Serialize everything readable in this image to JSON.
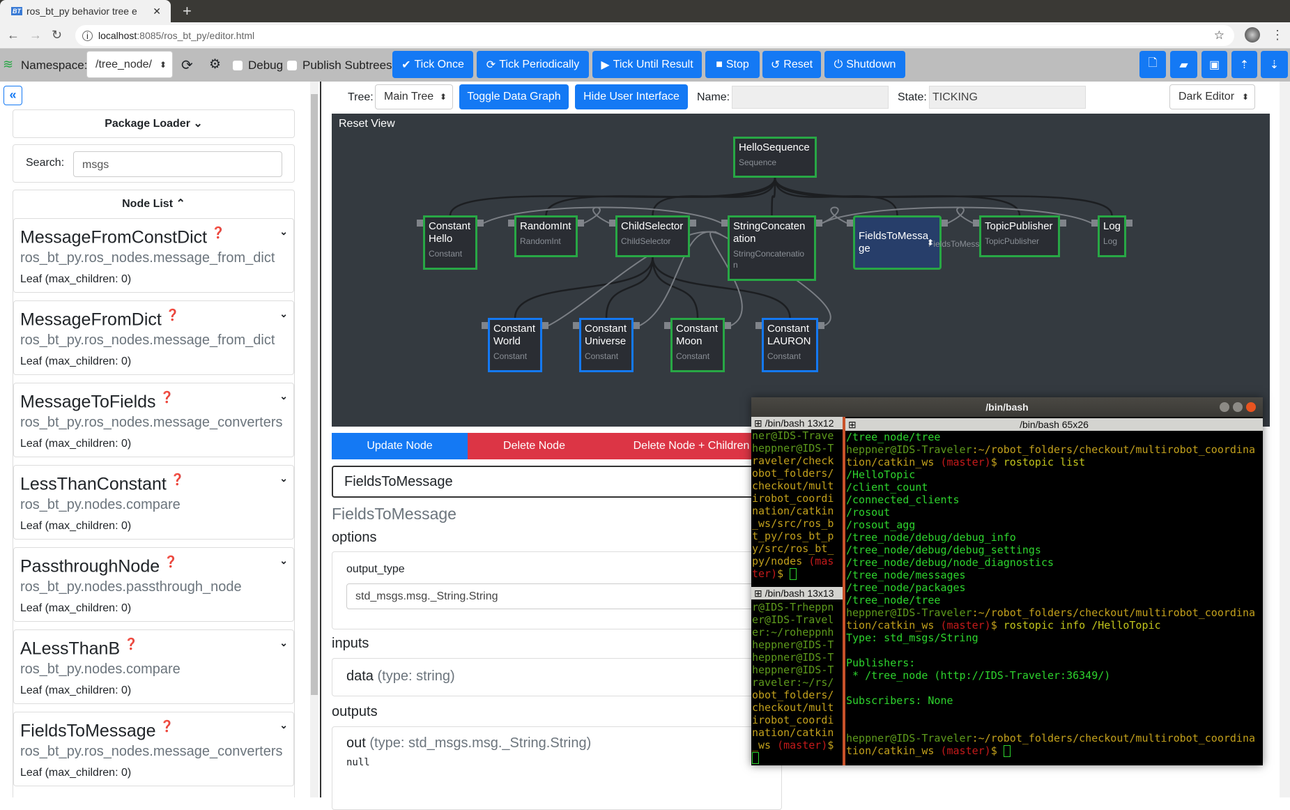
{
  "browser": {
    "tab_title": "ros_bt_py behavior tree e",
    "favicon": "BT",
    "url_host": "localhost",
    "url_rest": ":8085/ros_bt_py/editor.html"
  },
  "toolbar": {
    "namespace_label": "Namespace:",
    "namespace_value": "/tree_node/",
    "debug_label": "Debug",
    "publish_label": "Publish Subtrees",
    "tick_once": "Tick Once",
    "tick_periodically": "Tick Periodically",
    "tick_until_result": "Tick Until Result",
    "stop": "Stop",
    "reset": "Reset",
    "shutdown": "Shutdown",
    "right_icons": [
      "new-file-icon",
      "open-folder-icon",
      "save-icon",
      "upload-file-icon",
      "download-file-icon"
    ]
  },
  "sidebar": {
    "collapse": "«",
    "package_loader": "Package Loader ⌄",
    "search_label": "Search:",
    "search_value": "msgs",
    "node_list": "Node List ⌃",
    "items": [
      {
        "title": "MessageFromConstDict",
        "module": "ros_bt_py.ros_nodes.message_from_dict",
        "leaf": "Leaf (max_children: 0)"
      },
      {
        "title": "MessageFromDict",
        "module": "ros_bt_py.ros_nodes.message_from_dict",
        "leaf": "Leaf (max_children: 0)"
      },
      {
        "title": "MessageToFields",
        "module": "ros_bt_py.ros_nodes.message_converters",
        "leaf": "Leaf (max_children: 0)"
      },
      {
        "title": "LessThanConstant",
        "module": "ros_bt_py.nodes.compare",
        "leaf": "Leaf (max_children: 0)"
      },
      {
        "title": "PassthroughNode",
        "module": "ros_bt_py.nodes.passthrough_node",
        "leaf": "Leaf (max_children: 0)"
      },
      {
        "title": "ALessThanB",
        "module": "ros_bt_py.nodes.compare",
        "leaf": "Leaf (max_children: 0)"
      },
      {
        "title": "FieldsToMessage",
        "module": "ros_bt_py.ros_nodes.message_converters",
        "leaf": "Leaf (max_children: 0)"
      }
    ]
  },
  "treebar": {
    "tree_label": "Tree:",
    "tree_value": "Main Tree",
    "toggle_data_graph": "Toggle Data Graph",
    "hide_ui": "Hide User Interface",
    "name_label": "Name:",
    "name_value": "",
    "state_label": "State:",
    "state_value": "TICKING",
    "theme": "Dark Editor"
  },
  "graph": {
    "reset_view": "Reset View",
    "nodes": [
      {
        "id": "seq",
        "title": "HelloSequence",
        "type": "Sequence",
        "state": "green"
      },
      {
        "id": "hello",
        "title": "Constant Hello",
        "type": "Constant",
        "state": "green",
        "parent": "seq"
      },
      {
        "id": "rand",
        "title": "RandomInt",
        "type": "RandomInt",
        "state": "green",
        "parent": "seq"
      },
      {
        "id": "cs",
        "title": "ChildSelector",
        "type": "ChildSelector",
        "state": "green",
        "parent": "seq"
      },
      {
        "id": "sc",
        "title": "StringConcaten ation",
        "type": "StringConcatenatio n",
        "state": "green",
        "parent": "seq"
      },
      {
        "id": "ftm",
        "title": "FieldsToMessa ge",
        "type": "FieldsToMessage",
        "state": "green",
        "parent": "seq",
        "selected": true
      },
      {
        "id": "tp",
        "title": "TopicPublisher",
        "type": "TopicPublisher",
        "state": "green",
        "parent": "seq"
      },
      {
        "id": "log",
        "title": "Log",
        "type": "Log",
        "state": "green",
        "parent": "seq"
      },
      {
        "id": "world",
        "title": "Constant World",
        "type": "Constant",
        "state": "blue",
        "parent": "cs"
      },
      {
        "id": "univ",
        "title": "Constant Universe",
        "type": "Constant",
        "state": "blue",
        "parent": "cs"
      },
      {
        "id": "moon",
        "title": "Constant Moon",
        "type": "Constant",
        "state": "green",
        "parent": "cs"
      },
      {
        "id": "lauron",
        "title": "Constant LAURON",
        "type": "Constant",
        "state": "blue",
        "parent": "cs"
      }
    ],
    "data_edges": [
      [
        "hello",
        "sc"
      ],
      [
        "rand",
        "cs"
      ],
      [
        "world",
        "sc"
      ],
      [
        "univ",
        "sc"
      ],
      [
        "moon",
        "sc"
      ],
      [
        "lauron",
        "sc"
      ],
      [
        "sc",
        "ftm"
      ],
      [
        "ftm",
        "tp"
      ],
      [
        "sc",
        "log"
      ]
    ],
    "colors": {
      "green": "#28a745",
      "blue": "#1479f4",
      "selected_bg": "#273e6a"
    }
  },
  "editor": {
    "update": "Update Node",
    "delete": "Delete Node",
    "delete_children": "Delete Node + Children",
    "name_value": "FieldsToMessage",
    "node_class": "FieldsToMessage",
    "options_heading": "options",
    "option_key": "output_type",
    "option_value": "std_msgs.msg._String.String",
    "inputs_heading": "inputs",
    "input_name": "data",
    "input_type": "(type: string)",
    "outputs_heading": "outputs",
    "output_name": "out",
    "output_type": "(type: std_msgs.msg._String.String)",
    "output_value": "null"
  },
  "terminal": {
    "title": "/bin/bash",
    "pane1_title": "/bin/bash 13x12",
    "pane2_title": "/bin/bash 13x13",
    "pane3_title": "/bin/bash 65x26",
    "pane1": [
      [
        [
          "g",
          "ner@IDS-Trave"
        ]
      ],
      [
        [
          "g",
          "heppner@IDS-T"
        ]
      ],
      [
        [
          "y",
          "raveler/check"
        ]
      ],
      [
        [
          "y",
          "obot_folders/"
        ]
      ],
      [
        [
          "y",
          "checkout/mult"
        ]
      ],
      [
        [
          "y",
          "irobot_coordi"
        ]
      ],
      [
        [
          "y",
          "nation/catkin"
        ]
      ],
      [
        [
          "y",
          "_ws/src/ros_b"
        ]
      ],
      [
        [
          "y",
          "t_py/ros_bt_p"
        ]
      ],
      [
        [
          "y",
          "y/src/ros_bt_"
        ]
      ],
      [
        [
          "y",
          "py/nodes "
        ],
        [
          "r",
          "(mas"
        ]
      ],
      [
        [
          "r",
          "ter)"
        ],
        [
          "y",
          "$ "
        ],
        [
          "cur",
          ""
        ]
      ]
    ],
    "pane2": [
      [
        [
          "g",
          "r@IDS-Trheppn"
        ]
      ],
      [
        [
          "g",
          "er@IDS-Travel"
        ]
      ],
      [
        [
          "g",
          "er:~/roheppnh"
        ]
      ],
      [
        [
          "g",
          "heppner@IDS-T"
        ]
      ],
      [
        [
          "g",
          "heppner@IDS-T"
        ]
      ],
      [
        [
          "g",
          "heppner@IDS-T"
        ]
      ],
      [
        [
          "g",
          "raveler:~/rs/"
        ]
      ],
      [
        [
          "y",
          "obot_folders/"
        ]
      ],
      [
        [
          "y",
          "checkout/mult"
        ]
      ],
      [
        [
          "y",
          "irobot_coordi"
        ]
      ],
      [
        [
          "y",
          "nation/catkin"
        ]
      ],
      [
        [
          "y",
          "_ws "
        ],
        [
          "r",
          "(master)"
        ],
        [
          "y",
          "$"
        ]
      ],
      [
        [
          "cur",
          ""
        ]
      ]
    ],
    "pane3": [
      [
        [
          "o",
          "/tree_node/tree"
        ]
      ],
      [
        [
          "g",
          "heppner@IDS-Traveler"
        ],
        [
          "y",
          ":~/robot_folders/checkout/multirobot_coordina"
        ]
      ],
      [
        [
          "y",
          "tion/catkin_ws "
        ],
        [
          "r",
          "(master)"
        ],
        [
          "y",
          "$ "
        ],
        [
          "cmd",
          "rostopic list"
        ]
      ],
      [
        [
          "o",
          "/HelloTopic"
        ]
      ],
      [
        [
          "o",
          "/client_count"
        ]
      ],
      [
        [
          "o",
          "/connected_clients"
        ]
      ],
      [
        [
          "o",
          "/rosout"
        ]
      ],
      [
        [
          "o",
          "/rosout_agg"
        ]
      ],
      [
        [
          "o",
          "/tree_node/debug/debug_info"
        ]
      ],
      [
        [
          "o",
          "/tree_node/debug/debug_settings"
        ]
      ],
      [
        [
          "o",
          "/tree_node/debug/node_diagnostics"
        ]
      ],
      [
        [
          "o",
          "/tree_node/messages"
        ]
      ],
      [
        [
          "o",
          "/tree_node/packages"
        ]
      ],
      [
        [
          "o",
          "/tree_node/tree"
        ]
      ],
      [
        [
          "g",
          "heppner@IDS-Traveler"
        ],
        [
          "y",
          ":~/robot_folders/checkout/multirobot_coordina"
        ]
      ],
      [
        [
          "y",
          "tion/catkin_ws "
        ],
        [
          "r",
          "(master)"
        ],
        [
          "y",
          "$ "
        ],
        [
          "cmd",
          "rostopic info /HelloTopic"
        ]
      ],
      [
        [
          "o",
          "Type: std_msgs/String"
        ]
      ],
      [
        [
          "o",
          ""
        ]
      ],
      [
        [
          "o",
          "Publishers:"
        ]
      ],
      [
        [
          "o",
          " * /tree_node (http://IDS-Traveler:36349/)"
        ]
      ],
      [
        [
          "o",
          ""
        ]
      ],
      [
        [
          "o",
          "Subscribers: None"
        ]
      ],
      [
        [
          "o",
          ""
        ]
      ],
      [
        [
          "o",
          ""
        ]
      ],
      [
        [
          "g",
          "heppner@IDS-Traveler"
        ],
        [
          "y",
          ":~/robot_folders/checkout/multirobot_coordina"
        ]
      ],
      [
        [
          "y",
          "tion/catkin_ws "
        ],
        [
          "r",
          "(master)"
        ],
        [
          "y",
          "$ "
        ],
        [
          "cur",
          ""
        ]
      ]
    ]
  }
}
